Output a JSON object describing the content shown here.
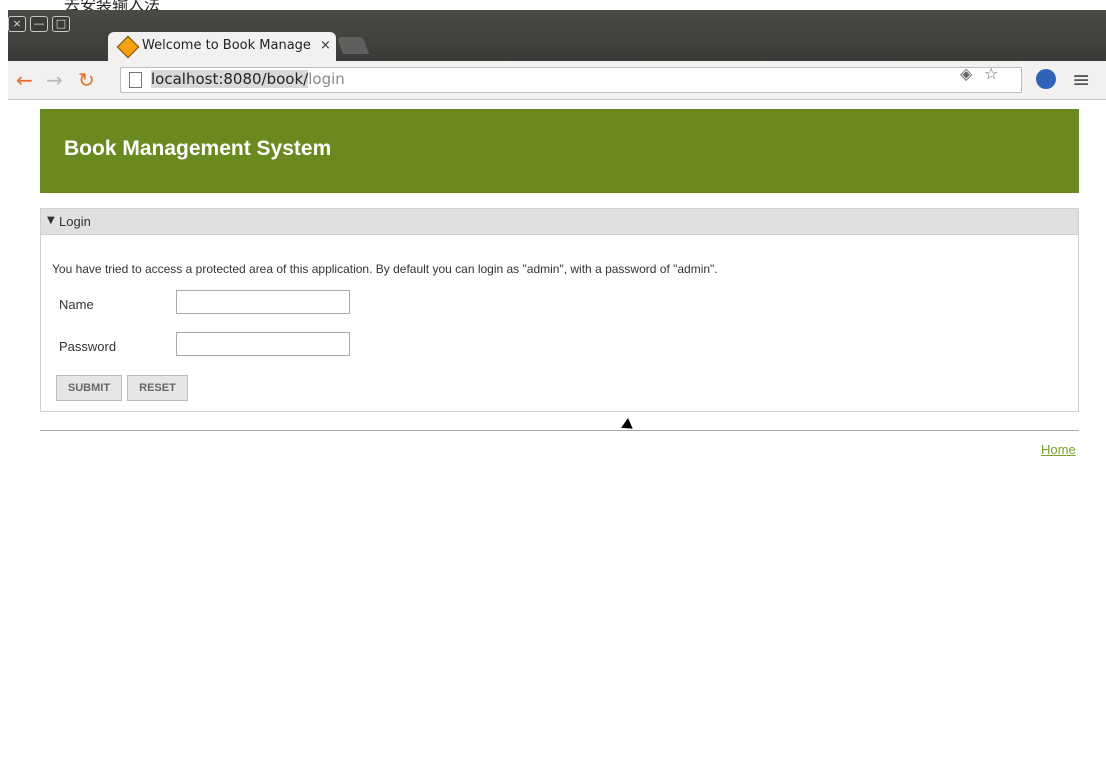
{
  "top_strip": {
    "text": "去安装输入法"
  },
  "browser": {
    "tab": {
      "title": "Welcome to Book Manage",
      "close": "×"
    },
    "url": {
      "host": "localhost:8080/book/",
      "path": "login"
    },
    "toolbar_icons": [
      "back-icon",
      "forward-icon",
      "reload-icon",
      "page-icon",
      "extension-icon",
      "star-icon",
      "globe-icon",
      "menu-icon"
    ]
  },
  "page": {
    "title": "Book Management System",
    "panel": {
      "title": "Login",
      "notice": "You have tried to access a protected area of this application. By default you can login as \"admin\", with a password of \"admin\".",
      "fields": {
        "name_label": "Name",
        "password_label": "Password"
      },
      "buttons": {
        "submit": "SUBMIT",
        "reset": "RESET"
      }
    },
    "footer": {
      "home": "Home"
    }
  }
}
